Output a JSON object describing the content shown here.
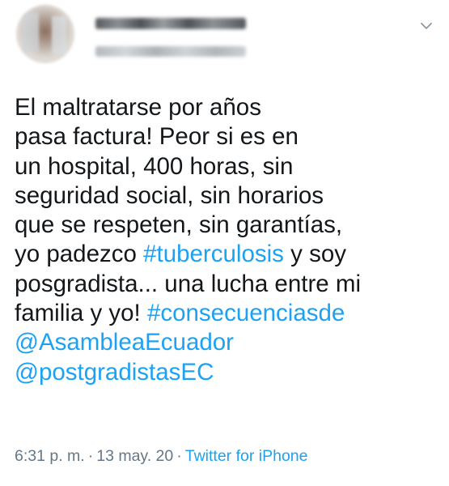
{
  "tweet": {
    "author": {
      "name_redacted": true,
      "handle_redacted": true
    },
    "menu_icon": "chevron-down-icon",
    "text_segments": [
      [
        {
          "t": "El maltratarse por años",
          "type": "text"
        }
      ],
      [
        {
          "t": "pasa factura! Peor si es en",
          "type": "text"
        }
      ],
      [
        {
          "t": "un hospital, 400 horas, sin",
          "type": "text"
        }
      ],
      [
        {
          "t": "seguridad social, sin horarios",
          "type": "text"
        }
      ],
      [
        {
          "t": "que se respeten, sin garantías,",
          "type": "text"
        }
      ],
      [
        {
          "t": "yo padezco ",
          "type": "text"
        },
        {
          "t": "#tuberculosis",
          "type": "hashtag"
        },
        {
          "t": " y soy",
          "type": "text"
        }
      ],
      [
        {
          "t": "posgradista... una lucha entre mi",
          "type": "text"
        }
      ],
      [
        {
          "t": "familia y yo! ",
          "type": "text"
        },
        {
          "t": "#consecuenciasde",
          "type": "hashtag"
        }
      ],
      [
        {
          "t": "@AsambleaEcuador",
          "type": "mention"
        }
      ],
      [
        {
          "t": "@postgradistasEC",
          "type": "mention"
        }
      ]
    ],
    "meta": {
      "time": "6:31 p. m.",
      "separator": "·",
      "date": "13 may. 20",
      "source": "Twitter for iPhone"
    }
  },
  "colors": {
    "text": "#14171a",
    "link": "#1da1f2",
    "meta": "#657786",
    "background": "#ffffff"
  }
}
